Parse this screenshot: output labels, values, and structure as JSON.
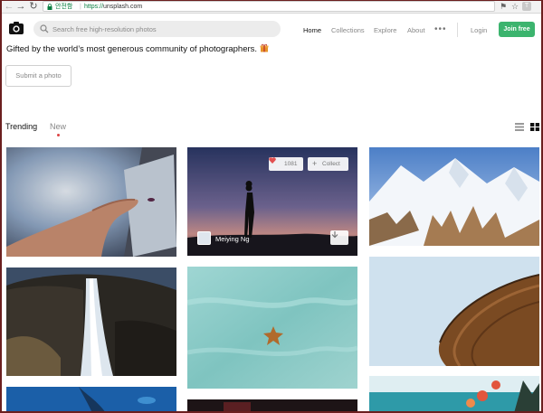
{
  "browser": {
    "secure_label": "안전함",
    "url_scheme": "https://",
    "url_host": "unsplash.com",
    "icons": [
      "back-icon",
      "forward-icon",
      "reload-icon",
      "lock-icon",
      "translate-icon",
      "star-icon",
      "extension-icon"
    ],
    "extension_label": "T"
  },
  "header": {
    "search_placeholder": "Search free high-resolution photos",
    "nav": {
      "home": "Home",
      "collections": "Collections",
      "explore": "Explore",
      "about": "About",
      "more": "•••"
    },
    "login": "Login",
    "join": "Join free",
    "accent_color": "#3cb46e"
  },
  "hero": {
    "tagline": "Gifted by the world’s most generous community of photographers.",
    "submit": "Submit a photo"
  },
  "tabs": {
    "trending": "Trending",
    "new": "New",
    "active": "New"
  },
  "featured_photo": {
    "likes": "1081",
    "collect": "Collect",
    "author": "Meiying Ng"
  },
  "photos": [
    "hand-tablet-photo",
    "starfield-silhouette-photo",
    "snowy-mountains-photo",
    "waterfall-photo",
    "starfish-photo",
    "stadium-roof-photo"
  ]
}
